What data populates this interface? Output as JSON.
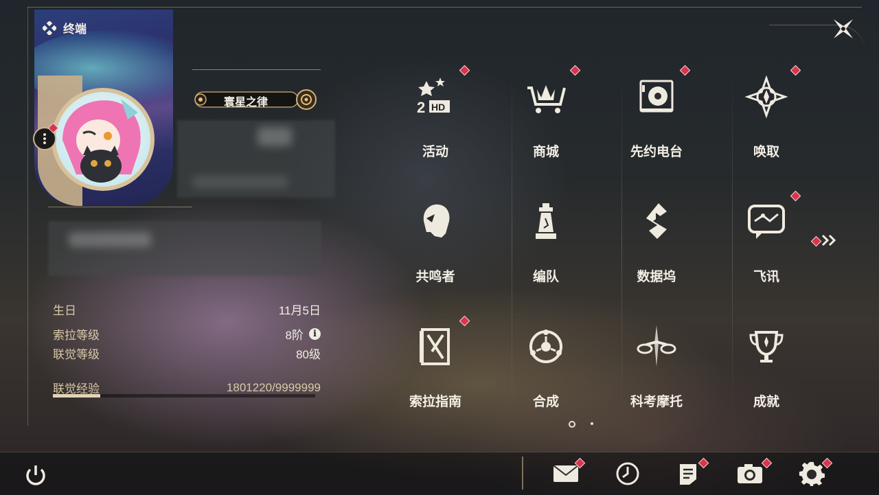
{
  "header": {
    "title": "终端"
  },
  "profile": {
    "title_badge": "寰星之律"
  },
  "stats": {
    "rows": [
      {
        "label": "生日",
        "value": "11月5日"
      },
      {
        "label": "索拉等级",
        "value": "8阶"
      },
      {
        "label": "联觉等级",
        "value": "80级"
      },
      {
        "label": "联觉经验",
        "value": "1801220/9999999"
      }
    ],
    "exp_progress": 0.18
  },
  "menu": {
    "items": [
      {
        "label": "活动",
        "icon": "event-2hd-icon",
        "badge": true
      },
      {
        "label": "商城",
        "icon": "shop-cart-icon",
        "badge": true
      },
      {
        "label": "先约电台",
        "icon": "radio-icon",
        "badge": true
      },
      {
        "label": "唤取",
        "icon": "convene-compass-icon",
        "badge": true
      },
      {
        "label": "共鸣者",
        "icon": "resonator-head-icon",
        "badge": false
      },
      {
        "label": "编队",
        "icon": "team-chess-icon",
        "badge": false
      },
      {
        "label": "数据坞",
        "icon": "data-bank-icon",
        "badge": false
      },
      {
        "label": "飞讯",
        "icon": "chat-icon",
        "badge": true
      },
      {
        "label": "索拉指南",
        "icon": "guide-book-icon",
        "badge": true
      },
      {
        "label": "合成",
        "icon": "synthesis-icon",
        "badge": false
      },
      {
        "label": "科考摩托",
        "icon": "motorcycle-icon",
        "badge": false
      },
      {
        "label": "成就",
        "icon": "trophy-icon",
        "badge": false
      }
    ]
  },
  "bottom": {
    "items": [
      {
        "icon": "mail-icon",
        "badge": true
      },
      {
        "icon": "clock-icon",
        "badge": false
      },
      {
        "icon": "notice-icon",
        "badge": true
      },
      {
        "icon": "camera-icon",
        "badge": true
      },
      {
        "icon": "settings-gear-icon",
        "badge": true
      }
    ]
  },
  "pagination": {
    "current": 1,
    "total": 2
  },
  "colors": {
    "accent": "#d9354b",
    "gold": "#c9b089",
    "text": "#f3efe6"
  }
}
